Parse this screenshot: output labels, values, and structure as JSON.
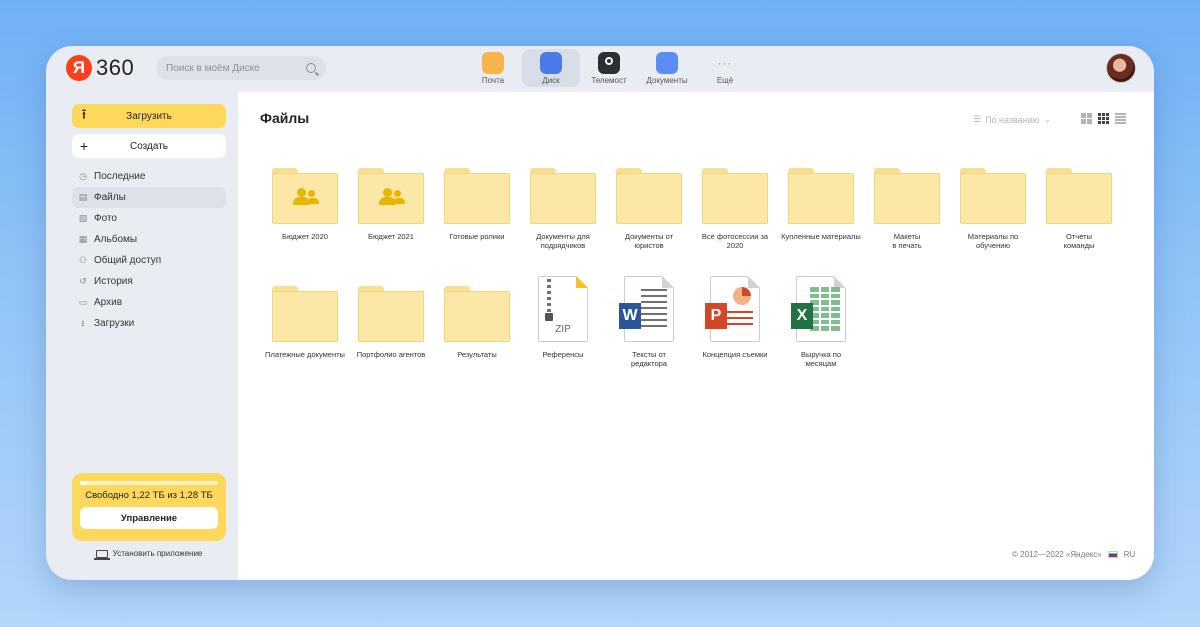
{
  "header": {
    "logo_ya": "Я",
    "logo_360": "360",
    "search_placeholder": "Поиск в моём Диске",
    "services": [
      {
        "label": "Почта",
        "color": "#f7b54b",
        "icon": "mail-icon"
      },
      {
        "label": "Диск",
        "color": "#4a7be8",
        "icon": "disk-icon",
        "active": true
      },
      {
        "label": "Телемост",
        "color": "#2b2f35",
        "icon": "telemost-icon"
      },
      {
        "label": "Документы",
        "color": "#5c8df6",
        "icon": "documents-icon"
      },
      {
        "label": "Ещё",
        "color": "#e9edf3",
        "icon": "more-icon"
      }
    ]
  },
  "sidebar": {
    "upload_label": "Загрузить",
    "create_label": "Создать",
    "nav": [
      {
        "label": "Последние",
        "icon": "clock-icon"
      },
      {
        "label": "Файлы",
        "icon": "files-icon",
        "active": true
      },
      {
        "label": "Фото",
        "icon": "photo-icon"
      },
      {
        "label": "Альбомы",
        "icon": "albums-icon"
      },
      {
        "label": "Общий доступ",
        "icon": "shared-access-icon"
      },
      {
        "label": "История",
        "icon": "history-icon"
      },
      {
        "label": "Архив",
        "icon": "archive-icon"
      },
      {
        "label": "Загрузки",
        "icon": "downloads-icon"
      }
    ],
    "storage_text": "Свободно 1,22 ТБ из 1,28 ТБ",
    "storage_used_fraction": 0.05,
    "manage_label": "Управление",
    "install_label": "Установить приложение"
  },
  "main": {
    "title": "Файлы",
    "sort_label": "По названию",
    "files": [
      {
        "name": "Бюджет 2020",
        "type": "shared-folder"
      },
      {
        "name": "Бюджет 2021",
        "type": "shared-folder"
      },
      {
        "name": "Готовые ролики",
        "type": "folder"
      },
      {
        "name": "Документы для\nподрядчиков",
        "type": "folder"
      },
      {
        "name": "Документы от\nюристов",
        "type": "folder"
      },
      {
        "name": "Все фотосессии за\n2020",
        "type": "folder"
      },
      {
        "name": "Купленные материалы",
        "type": "folder"
      },
      {
        "name": "Макеты\nв печать",
        "type": "folder"
      },
      {
        "name": "Материалы по\nобучению",
        "type": "folder"
      },
      {
        "name": "Отчеты\nкоманды",
        "type": "folder"
      },
      {
        "name": "Платежные документы",
        "type": "folder"
      },
      {
        "name": "Портфолио агентов",
        "type": "folder"
      },
      {
        "name": "Результаты",
        "type": "folder"
      },
      {
        "name": "Референсы",
        "type": "zip",
        "label": "ZIP"
      },
      {
        "name": "Тексты от\nредактора",
        "type": "word",
        "badge": "W",
        "color": "#2b579a"
      },
      {
        "name": "Концепция съемки",
        "type": "ppt",
        "badge": "P",
        "color": "#d24726"
      },
      {
        "name": "Выручка по\nмесяцам",
        "type": "excel",
        "badge": "X",
        "color": "#217346"
      }
    ],
    "footer_copyright": "© 2012—2022 «Яндекс»",
    "footer_lang": "RU"
  }
}
